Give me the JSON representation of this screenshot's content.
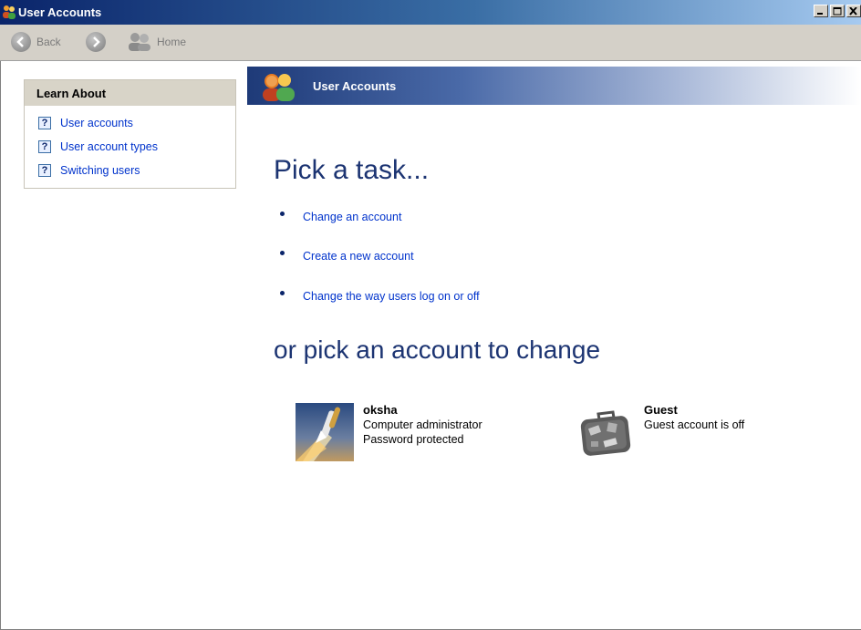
{
  "window": {
    "title": "User Accounts"
  },
  "toolbar": {
    "back_label": "Back",
    "home_label": "Home"
  },
  "learn_about": {
    "header": "Learn About",
    "items": [
      {
        "label": "User accounts"
      },
      {
        "label": "User account types"
      },
      {
        "label": "Switching users"
      }
    ]
  },
  "banner": {
    "title": "User Accounts"
  },
  "main": {
    "task_heading": "Pick a task...",
    "tasks": [
      {
        "label": "Change an account"
      },
      {
        "label": "Create a new account"
      },
      {
        "label": "Change the way users log on or off"
      }
    ],
    "account_heading": "or pick an account to change",
    "accounts": [
      {
        "name": "oksha",
        "line1": "Computer administrator",
        "line2": "Password protected",
        "picture": "space-shuttle-launch"
      },
      {
        "name": "Guest",
        "line1": "Guest account is off",
        "line2": "",
        "picture": "suitcase"
      }
    ]
  },
  "icons": {
    "help": "?",
    "app": "users-icon"
  },
  "colors": {
    "title_bar": "#0a246a",
    "heading": "#1c3472",
    "link": "#0033cc"
  }
}
